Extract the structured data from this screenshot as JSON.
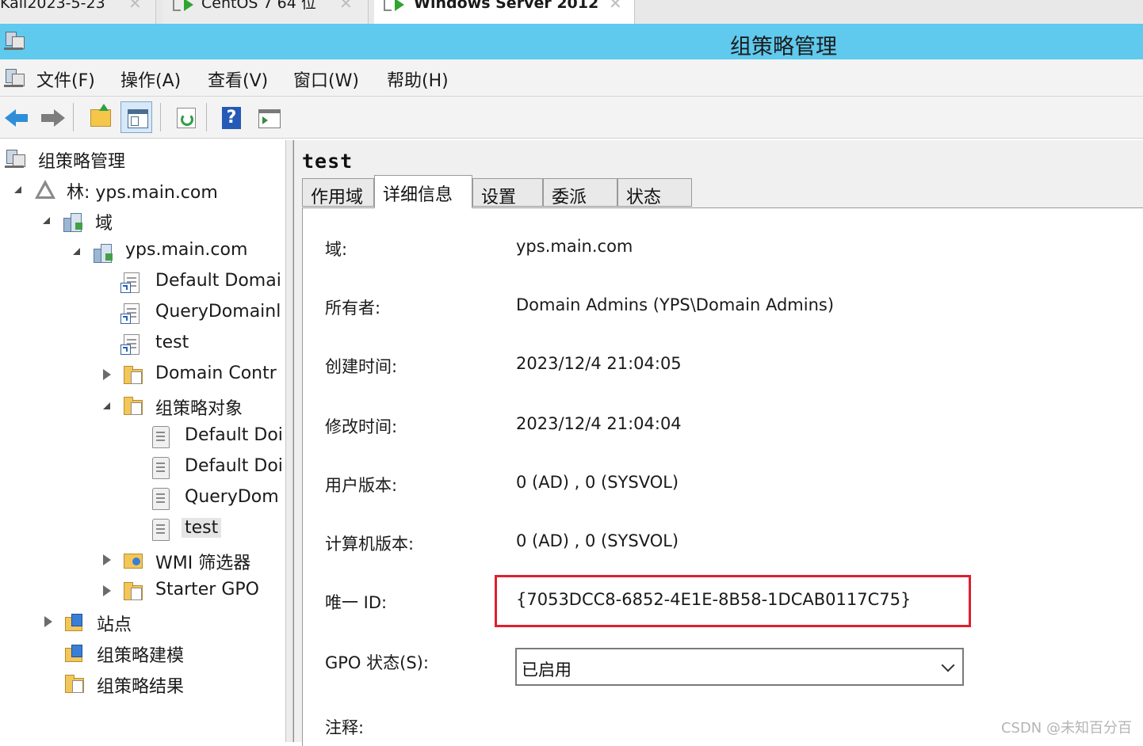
{
  "vm_tabs": [
    {
      "label": "Kali2023-5-23",
      "active": false
    },
    {
      "label": "CentOS 7 64 位",
      "active": false
    },
    {
      "label": "Windows Server 2012",
      "active": true
    }
  ],
  "window": {
    "title": "组策略管理"
  },
  "menu": [
    "文件(F)",
    "操作(A)",
    "查看(V)",
    "窗口(W)",
    "帮助(H)"
  ],
  "toolbar": {
    "buttons": [
      "back-icon",
      "forward-icon",
      "up-folder-icon",
      "show-hide-tree-icon",
      "refresh-icon",
      "help-icon",
      "action-pane-icon"
    ]
  },
  "tree": [
    {
      "label": "组策略管理",
      "icon": "gpmc-icon",
      "expander": "none"
    },
    {
      "label": "林: yps.main.com",
      "icon": "forest-icon",
      "expander": "open"
    },
    {
      "label": "域",
      "icon": "domains-icon",
      "expander": "open"
    },
    {
      "label": "yps.main.com",
      "icon": "domain-icon",
      "expander": "open"
    },
    {
      "label": "Default Domai",
      "icon": "gpo-link-icon",
      "expander": "none"
    },
    {
      "label": "QueryDomainl",
      "icon": "gpo-link-icon",
      "expander": "none"
    },
    {
      "label": "test",
      "icon": "gpo-link-icon",
      "expander": "none"
    },
    {
      "label": "Domain Contr",
      "icon": "ou-folder-icon",
      "expander": "closed"
    },
    {
      "label": "组策略对象",
      "icon": "gpo-folder-icon",
      "expander": "open"
    },
    {
      "label": "Default Doi",
      "icon": "gpo-icon",
      "expander": "none"
    },
    {
      "label": "Default Doi",
      "icon": "gpo-icon",
      "expander": "none"
    },
    {
      "label": "QueryDom",
      "icon": "gpo-icon",
      "expander": "none"
    },
    {
      "label": "test",
      "icon": "gpo-icon",
      "expander": "none",
      "selected": true
    },
    {
      "label": "WMI 筛选器",
      "icon": "wmi-filter-icon",
      "expander": "closed"
    },
    {
      "label": "Starter GPO",
      "icon": "starter-gpo-icon",
      "expander": "closed"
    },
    {
      "label": "站点",
      "icon": "sites-icon",
      "expander": "closed"
    },
    {
      "label": "组策略建模",
      "icon": "gp-modeling-icon",
      "expander": "none"
    },
    {
      "label": "组策略结果",
      "icon": "gp-results-icon",
      "expander": "none"
    }
  ],
  "details": {
    "header": "test",
    "tabs": [
      "作用域",
      "详细信息",
      "设置",
      "委派",
      "状态"
    ],
    "active_tab": "详细信息",
    "fields": {
      "domain_label": "域:",
      "domain_value": "yps.main.com",
      "owner_label": "所有者:",
      "owner_value": "Domain Admins (YPS\\Domain Admins)",
      "created_label": "创建时间:",
      "created_value": "2023/12/4 21:04:05",
      "modified_label": "修改时间:",
      "modified_value": "2023/12/4 21:04:04",
      "user_version_label": "用户版本:",
      "user_version_value": "0 (AD) , 0 (SYSVOL)",
      "computer_version_label": "计算机版本:",
      "computer_version_value": "0 (AD) , 0 (SYSVOL)",
      "unique_id_label": "唯一 ID:",
      "unique_id_value": "{7053DCC8-6852-4E1E-8B58-1DCAB0117C75}",
      "gpo_status_label": "GPO 状态(S):",
      "gpo_status_value": "已启用",
      "comment_label": "注释:"
    }
  },
  "colors": {
    "titlebar": "#5fc9ee",
    "highlight_box": "#e01f2e"
  },
  "watermark": "CSDN @未知百分百"
}
